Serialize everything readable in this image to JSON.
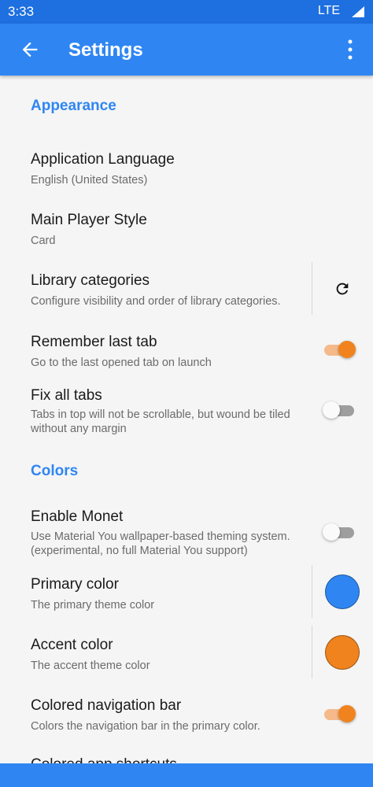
{
  "status_bar": {
    "time": "3:33",
    "network": "LTE"
  },
  "app_bar": {
    "title": "Settings",
    "back_icon": "arrow-back-icon",
    "more_icon": "more-vert-icon"
  },
  "sections": {
    "appearance": "Appearance",
    "colors": "Colors"
  },
  "prefs": {
    "app_language": {
      "title": "Application Language",
      "summary": "English (United States)"
    },
    "player_style": {
      "title": "Main Player Style",
      "summary": "Card"
    },
    "library_categories": {
      "title": "Library categories",
      "summary": "Configure visibility and order of library categories.",
      "icon": "refresh-icon"
    },
    "remember_tab": {
      "title": "Remember last tab",
      "summary": "Go to the last opened tab on launch",
      "enabled": true
    },
    "fix_tabs": {
      "title": "Fix all tabs",
      "summary": "Tabs in top will not be scrollable, but wound be tiled without any margin",
      "enabled": false
    },
    "monet": {
      "title": "Enable Monet",
      "summary": "Use Material You wallpaper-based theming system. (experimental, no full Material You support)",
      "enabled": false
    },
    "primary_color": {
      "title": "Primary color",
      "summary": "The primary theme color",
      "color": "#2f86f3"
    },
    "accent_color": {
      "title": "Accent color",
      "summary": "The accent theme color",
      "color": "#f0831e"
    },
    "colored_nav": {
      "title": "Colored navigation bar",
      "summary": "Colors the navigation bar in the primary color.",
      "enabled": true
    },
    "colored_shortcuts": {
      "title": "Colored app shortcuts"
    }
  },
  "theme": {
    "primary": "#2f86f3",
    "accent": "#f0831e",
    "status_bar": "#1e6fe0"
  }
}
